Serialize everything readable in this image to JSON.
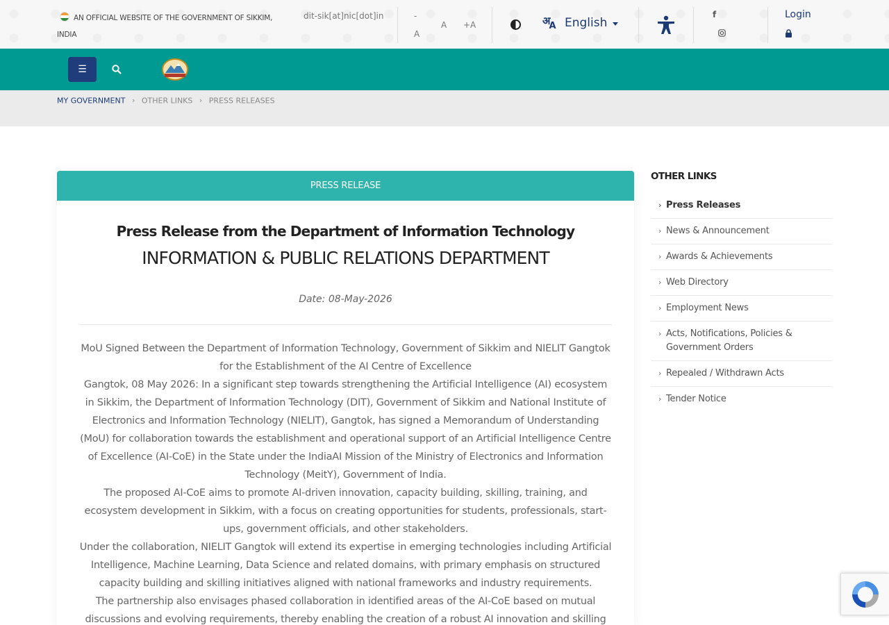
{
  "topbar": {
    "gov_label": "AN OFFICIAL WEBSITE OF THE GOVERNMENT OF SIKKIM, INDIA",
    "email": "dit-sik[at]nic[dot]in",
    "font_decrease": "-A",
    "font_normal": "A",
    "font_increase": "+A",
    "language": "English",
    "login": "Login"
  },
  "breadcrumb": [
    "MY GOVERNMENT",
    "OTHER LINKS",
    "PRESS RELEASES"
  ],
  "card": {
    "header": "PRESS RELEASE",
    "title": "Press Release from the Department of Information Technology",
    "department": "INFORMATION & PUBLIC RELATIONS DEPARTMENT",
    "date": "Date: 08-May-2026",
    "paragraphs": [
      "MoU Signed Between the Department of Information Technology, Government of Sikkim and NIELIT Gangtok for the Establishment of the AI Centre of Excellence",
      "Gangtok, 08 May 2026:  In a significant step towards strengthening the Artificial Intelligence (AI) ecosystem in Sikkim, the Department of Information Technology (DIT), Government of Sikkim and National Institute of Electronics and Information Technology (NIELIT), Gangtok, has signed a Memorandum of Understanding (MoU) for collaboration towards the establishment and operational support of an Artificial Intelligence Centre of Excellence (AI-CoE) in the State under the IndiaAI Mission of the Ministry of Electronics and Information Technology (MeitY), Government of India.",
      "The proposed AI-CoE aims to promote AI-driven innovation, capacity building, skilling, training, and ecosystem development in Sikkim, with a focus on creating opportunities for students, professionals, start-ups, government officials, and other stakeholders.",
      "Under the collaboration, NIELIT Gangtok will extend its expertise in emerging technologies including Artificial Intelligence, Machine Learning, Data Science and related domains, with primary emphasis on structured capacity building and skilling initiatives aligned with national frameworks and industry requirements.",
      "The partnership also envisages phased collaboration in identified areas of the AI-CoE based on mutual discussions and evolving requirements, thereby enabling the creation of a robust AI innovation and skilling"
    ]
  },
  "sidebar": {
    "title": "OTHER LINKS",
    "items": [
      "Press Releases",
      "News & Announcement",
      "Awards & Achievements",
      "Web Directory",
      "Employment News",
      "Acts, Notifications, Policies & Government Orders",
      "Repealed / Withdrawn Acts",
      "Tender Notice"
    ]
  },
  "colors": {
    "nav_teal": "#009a92",
    "card_header_teal": "#2fb3ad",
    "brand_navy": "#1f3d7a"
  }
}
